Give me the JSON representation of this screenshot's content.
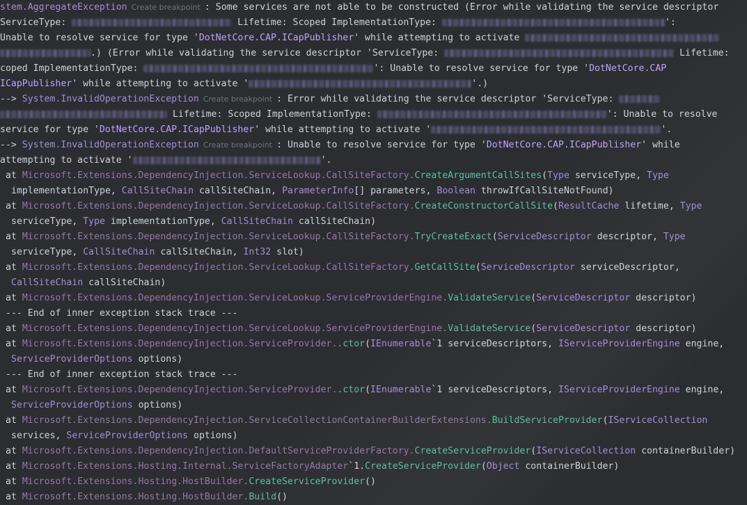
{
  "breakpoint_label": "Create breakpoint",
  "lines": [
    {
      "indent": 0,
      "segs": [
        {
          "c": "t-exc",
          "t": "stem.AggregateException"
        },
        {
          "c": "t-bp",
          "t": "Create breakpoint"
        },
        {
          "c": "t-txt",
          "t": ": Some services are not able to be constructed (Error while validating the service descriptor"
        }
      ]
    },
    {
      "indent": 0,
      "segs": [
        {
          "c": "t-txt",
          "t": "ServiceType: "
        },
        {
          "blur": 230
        },
        {
          "c": "t-txt",
          "t": " Lifetime: Scoped ImplementationType: "
        },
        {
          "blur": 320
        },
        {
          "c": "t-txt",
          "t": "':"
        }
      ]
    },
    {
      "indent": 0,
      "segs": [
        {
          "c": "t-txt",
          "t": "Unable to resolve service for type '"
        },
        {
          "c": "t-str",
          "t": "DotNetCore.CAP.ICapPublisher"
        },
        {
          "c": "t-txt",
          "t": "' while attempting to activate "
        },
        {
          "blur": 280
        }
      ]
    },
    {
      "indent": 0,
      "segs": [
        {
          "blur": 130
        },
        {
          "c": "t-txt",
          "t": ".) (Error while validating the service descriptor 'ServiceType: "
        },
        {
          "blur": 330
        },
        {
          "c": "t-txt",
          "t": " Lifetime:"
        }
      ]
    },
    {
      "indent": 0,
      "segs": [
        {
          "c": "t-txt",
          "t": "coped ImplementationType: "
        },
        {
          "blur": 330
        },
        {
          "c": "t-txt",
          "t": "': Unable to resolve service for type '"
        },
        {
          "c": "t-str",
          "t": "DotNetCore.CAP"
        }
      ]
    },
    {
      "indent": 0,
      "segs": [
        {
          "c": "t-str",
          "t": "ICapPublisher"
        },
        {
          "c": "t-txt",
          "t": "' while attempting to activate '"
        },
        {
          "blur": 320
        },
        {
          "c": "t-txt",
          "t": "'.)"
        }
      ]
    },
    {
      "indent": 0,
      "segs": [
        {
          "c": "t-txt",
          "t": "--> "
        },
        {
          "c": "t-exc",
          "t": "System.InvalidOperationException"
        },
        {
          "c": "t-bp",
          "t": "Create breakpoint"
        },
        {
          "c": "t-txt",
          "t": ": Error while validating the service descriptor 'ServiceType: "
        },
        {
          "blur": 60
        }
      ]
    },
    {
      "indent": 0,
      "segs": [
        {
          "blur": 240
        },
        {
          "c": "t-txt",
          "t": " Lifetime: Scoped ImplementationType: "
        },
        {
          "blur": 330
        },
        {
          "c": "t-txt",
          "t": "': Unable to resolve"
        }
      ]
    },
    {
      "indent": 0,
      "segs": [
        {
          "c": "t-txt",
          "t": "service for type '"
        },
        {
          "c": "t-str",
          "t": "DotNetCore.CAP.ICapPublisher"
        },
        {
          "c": "t-txt",
          "t": "' while attempting to activate '"
        },
        {
          "blur": 330
        },
        {
          "c": "t-txt",
          "t": "'."
        }
      ]
    },
    {
      "indent": 0,
      "segs": [
        {
          "c": "t-txt",
          "t": "--> "
        },
        {
          "c": "t-exc",
          "t": "System.InvalidOperationException"
        },
        {
          "c": "t-bp",
          "t": "Create breakpoint"
        },
        {
          "c": "t-txt",
          "t": ": Unable to resolve service for type '"
        },
        {
          "c": "t-str",
          "t": "DotNetCore.CAP.ICapPublisher"
        },
        {
          "c": "t-txt",
          "t": "' while"
        }
      ]
    },
    {
      "indent": 0,
      "segs": [
        {
          "c": "t-txt",
          "t": "attempting to activate '"
        },
        {
          "blur": 270
        },
        {
          "c": "t-txt",
          "t": "'."
        }
      ]
    },
    {
      "indent": 1,
      "segs": [
        {
          "c": "t-txt",
          "t": "at "
        },
        {
          "c": "t-ns",
          "t": "Microsoft.Extensions.DependencyInjection.ServiceLookup.CallSiteFactory."
        },
        {
          "c": "t-m",
          "t": "CreateArgumentCallSites"
        },
        {
          "c": "t-txt",
          "t": "("
        },
        {
          "c": "t-ty",
          "t": "Type"
        },
        {
          "c": "t-txt",
          "t": " serviceType, "
        },
        {
          "c": "t-ty",
          "t": "Type"
        }
      ]
    },
    {
      "indent": 2,
      "segs": [
        {
          "c": "t-txt",
          "t": "implementationType, "
        },
        {
          "c": "t-ty",
          "t": "CallSiteChain"
        },
        {
          "c": "t-txt",
          "t": " callSiteChain, "
        },
        {
          "c": "t-ty",
          "t": "ParameterInfo"
        },
        {
          "c": "t-txt",
          "t": "[] parameters, "
        },
        {
          "c": "t-ty",
          "t": "Boolean"
        },
        {
          "c": "t-txt",
          "t": " throwIfCallSiteNotFound)"
        }
      ]
    },
    {
      "indent": 1,
      "segs": [
        {
          "c": "t-txt",
          "t": "at "
        },
        {
          "c": "t-ns",
          "t": "Microsoft.Extensions.DependencyInjection.ServiceLookup.CallSiteFactory."
        },
        {
          "c": "t-m",
          "t": "CreateConstructorCallSite"
        },
        {
          "c": "t-txt",
          "t": "("
        },
        {
          "c": "t-ty",
          "t": "ResultCache"
        },
        {
          "c": "t-txt",
          "t": " lifetime, "
        },
        {
          "c": "t-ty",
          "t": "Type"
        }
      ]
    },
    {
      "indent": 2,
      "segs": [
        {
          "c": "t-txt",
          "t": "serviceType, "
        },
        {
          "c": "t-ty",
          "t": "Type"
        },
        {
          "c": "t-txt",
          "t": " implementationType, "
        },
        {
          "c": "t-ty",
          "t": "CallSiteChain"
        },
        {
          "c": "t-txt",
          "t": " callSiteChain)"
        }
      ]
    },
    {
      "indent": 1,
      "segs": [
        {
          "c": "t-txt",
          "t": "at "
        },
        {
          "c": "t-ns",
          "t": "Microsoft.Extensions.DependencyInjection.ServiceLookup.CallSiteFactory."
        },
        {
          "c": "t-m",
          "t": "TryCreateExact"
        },
        {
          "c": "t-txt",
          "t": "("
        },
        {
          "c": "t-ty",
          "t": "ServiceDescriptor"
        },
        {
          "c": "t-txt",
          "t": " descriptor, "
        },
        {
          "c": "t-ty",
          "t": "Type"
        }
      ]
    },
    {
      "indent": 2,
      "segs": [
        {
          "c": "t-txt",
          "t": "serviceType, "
        },
        {
          "c": "t-ty",
          "t": "CallSiteChain"
        },
        {
          "c": "t-txt",
          "t": " callSiteChain, "
        },
        {
          "c": "t-ty",
          "t": "Int32"
        },
        {
          "c": "t-txt",
          "t": " slot)"
        }
      ]
    },
    {
      "indent": 1,
      "segs": [
        {
          "c": "t-txt",
          "t": "at "
        },
        {
          "c": "t-ns",
          "t": "Microsoft.Extensions.DependencyInjection.ServiceLookup.CallSiteFactory."
        },
        {
          "c": "t-m",
          "t": "GetCallSite"
        },
        {
          "c": "t-txt",
          "t": "("
        },
        {
          "c": "t-ty",
          "t": "ServiceDescriptor"
        },
        {
          "c": "t-txt",
          "t": " serviceDescriptor,"
        }
      ]
    },
    {
      "indent": 2,
      "segs": [
        {
          "c": "t-ty",
          "t": "CallSiteChain"
        },
        {
          "c": "t-txt",
          "t": " callSiteChain)"
        }
      ]
    },
    {
      "indent": 1,
      "segs": [
        {
          "c": "t-txt",
          "t": "at "
        },
        {
          "c": "t-ns",
          "t": "Microsoft.Extensions.DependencyInjection.ServiceLookup.ServiceProviderEngine."
        },
        {
          "c": "t-m",
          "t": "ValidateService"
        },
        {
          "c": "t-txt",
          "t": "("
        },
        {
          "c": "t-ty",
          "t": "ServiceDescriptor"
        },
        {
          "c": "t-txt",
          "t": " descriptor)"
        }
      ]
    },
    {
      "indent": 1,
      "segs": [
        {
          "c": "t-txt",
          "t": "--- End of inner exception stack trace ---"
        }
      ]
    },
    {
      "indent": 1,
      "segs": [
        {
          "c": "t-txt",
          "t": "at "
        },
        {
          "c": "t-ns",
          "t": "Microsoft.Extensions.DependencyInjection.ServiceLookup.ServiceProviderEngine."
        },
        {
          "c": "t-m",
          "t": "ValidateService"
        },
        {
          "c": "t-txt",
          "t": "("
        },
        {
          "c": "t-ty",
          "t": "ServiceDescriptor"
        },
        {
          "c": "t-txt",
          "t": " descriptor)"
        }
      ]
    },
    {
      "indent": 1,
      "segs": [
        {
          "c": "t-txt",
          "t": "at "
        },
        {
          "c": "t-ns",
          "t": "Microsoft.Extensions.DependencyInjection.ServiceProvider."
        },
        {
          "c": "t-m",
          "t": ".ctor"
        },
        {
          "c": "t-txt",
          "t": "("
        },
        {
          "c": "t-ty",
          "t": "IEnumerable"
        },
        {
          "c": "t-txt",
          "t": "`1 serviceDescriptors, "
        },
        {
          "c": "t-ty",
          "t": "IServiceProviderEngine"
        },
        {
          "c": "t-txt",
          "t": " engine,"
        }
      ]
    },
    {
      "indent": 2,
      "segs": [
        {
          "c": "t-ty",
          "t": "ServiceProviderOptions"
        },
        {
          "c": "t-txt",
          "t": " options)"
        }
      ]
    },
    {
      "indent": 1,
      "segs": [
        {
          "c": "t-txt",
          "t": "--- End of inner exception stack trace ---"
        }
      ]
    },
    {
      "indent": 1,
      "segs": [
        {
          "c": "t-txt",
          "t": "at "
        },
        {
          "c": "t-ns",
          "t": "Microsoft.Extensions.DependencyInjection.ServiceProvider."
        },
        {
          "c": "t-m",
          "t": ".ctor"
        },
        {
          "c": "t-txt",
          "t": "("
        },
        {
          "c": "t-ty",
          "t": "IEnumerable"
        },
        {
          "c": "t-txt",
          "t": "`1 serviceDescriptors, "
        },
        {
          "c": "t-ty",
          "t": "IServiceProviderEngine"
        },
        {
          "c": "t-txt",
          "t": " engine,"
        }
      ]
    },
    {
      "indent": 2,
      "segs": [
        {
          "c": "t-ty",
          "t": "ServiceProviderOptions"
        },
        {
          "c": "t-txt",
          "t": " options)"
        }
      ]
    },
    {
      "indent": 1,
      "segs": [
        {
          "c": "t-txt",
          "t": "at "
        },
        {
          "c": "t-ns",
          "t": "Microsoft.Extensions.DependencyInjection.ServiceCollectionContainerBuilderExtensions."
        },
        {
          "c": "t-m",
          "t": "BuildServiceProvider"
        },
        {
          "c": "t-txt",
          "t": "("
        },
        {
          "c": "t-ty",
          "t": "IServiceCollection"
        }
      ]
    },
    {
      "indent": 2,
      "segs": [
        {
          "c": "t-txt",
          "t": "services, "
        },
        {
          "c": "t-ty",
          "t": "ServiceProviderOptions"
        },
        {
          "c": "t-txt",
          "t": " options)"
        }
      ]
    },
    {
      "indent": 1,
      "segs": [
        {
          "c": "t-txt",
          "t": "at "
        },
        {
          "c": "t-ns",
          "t": "Microsoft.Extensions.DependencyInjection.DefaultServiceProviderFactory."
        },
        {
          "c": "t-m",
          "t": "CreateServiceProvider"
        },
        {
          "c": "t-txt",
          "t": "("
        },
        {
          "c": "t-ty",
          "t": "IServiceCollection"
        },
        {
          "c": "t-txt",
          "t": " containerBuilder)"
        }
      ]
    },
    {
      "indent": 1,
      "segs": [
        {
          "c": "t-txt",
          "t": "at "
        },
        {
          "c": "t-ns",
          "t": "Microsoft.Extensions.Hosting.Internal.ServiceFactoryAdapter"
        },
        {
          "c": "t-txt",
          "t": "`1."
        },
        {
          "c": "t-m",
          "t": "CreateServiceProvider"
        },
        {
          "c": "t-txt",
          "t": "("
        },
        {
          "c": "t-ty",
          "t": "Object"
        },
        {
          "c": "t-txt",
          "t": " containerBuilder)"
        }
      ]
    },
    {
      "indent": 1,
      "segs": [
        {
          "c": "t-txt",
          "t": "at "
        },
        {
          "c": "t-ns",
          "t": "Microsoft.Extensions.Hosting.HostBuilder."
        },
        {
          "c": "t-m",
          "t": "CreateServiceProvider"
        },
        {
          "c": "t-txt",
          "t": "()"
        }
      ]
    },
    {
      "indent": 1,
      "segs": [
        {
          "c": "t-txt",
          "t": "at "
        },
        {
          "c": "t-ns",
          "t": "Microsoft.Extensions.Hosting.HostBuilder."
        },
        {
          "c": "t-m",
          "t": "Build"
        },
        {
          "c": "t-txt",
          "t": "()"
        }
      ]
    }
  ]
}
